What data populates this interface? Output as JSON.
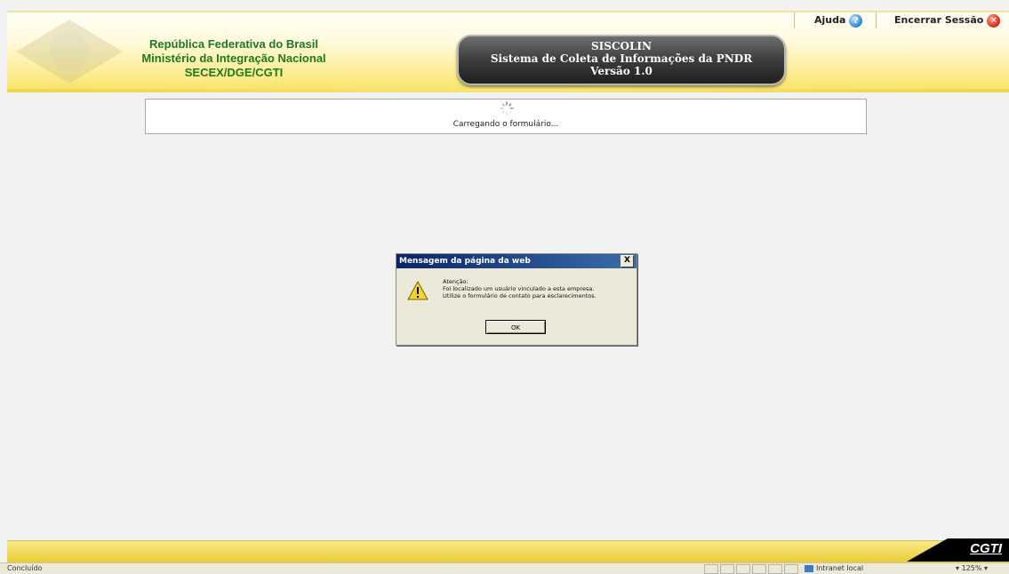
{
  "header": {
    "org_lines": [
      "República Federativa do Brasil",
      "Ministério da Integração Nacional",
      "SECEX/DGE/CGTI"
    ],
    "system": {
      "name": "SISCOLIN",
      "description": "Sistema de Coleta de Informações da PNDR",
      "version": "Versão 1.0"
    },
    "links": {
      "help": "Ajuda",
      "logout": "Encerrar Sessão"
    }
  },
  "loading": {
    "text": "Carregando o formulário..."
  },
  "dialog": {
    "title": "Mensagem da página da web",
    "close_glyph": "X",
    "message_lines": [
      "Atenção:",
      "Foi localizado um usuário vinculado a esta empresa.",
      "Utilize o formulário de contato para esclarecimentos."
    ],
    "ok_label": "OK"
  },
  "footer": {
    "logo_text": "CGTI"
  },
  "status_bar": {
    "text": "Concluído",
    "zone": "Intranet local",
    "zoom": "125%"
  },
  "colors": {
    "org_text": "#1d7a1d",
    "header_yellow": "#f7e36a",
    "dialog_title": "#0a246a"
  }
}
